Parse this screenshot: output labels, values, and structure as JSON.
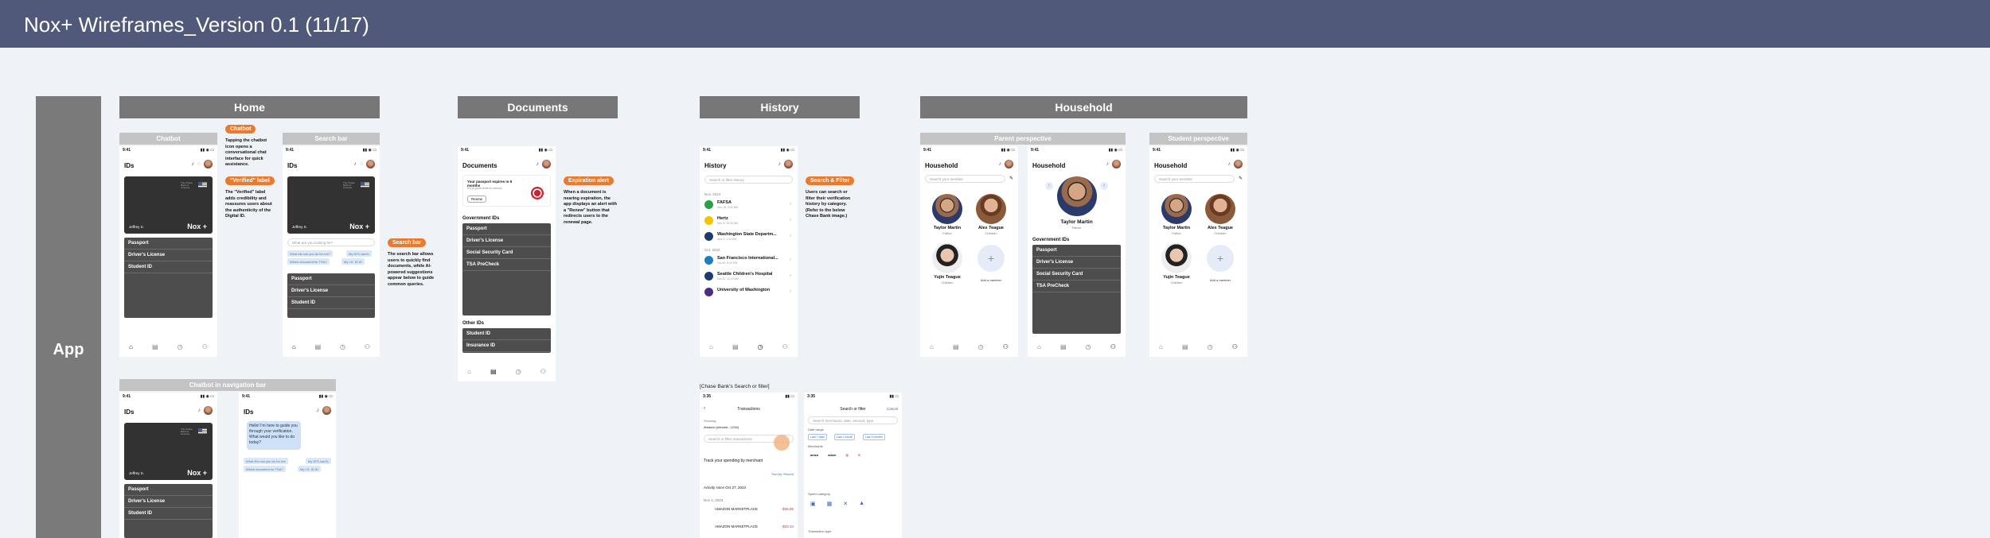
{
  "board": {
    "title": "Nox+ Wireframes_Version 0.1 (11/17)",
    "app_label": "App"
  },
  "sections": {
    "home": "Home",
    "documents": "Documents",
    "history": "History",
    "household": "Household"
  },
  "subs": {
    "chatbot": "Chatbot",
    "search_bar": "Search bar",
    "chatbot_nav": "Chatbot in navigation bar",
    "parent": "Parent perspective",
    "student": "Student perspective"
  },
  "phone": {
    "time": "9:41",
    "ids": "IDs",
    "documents": "Documents",
    "history": "History",
    "household": "Household",
    "holder": "Jeffrey S.",
    "brand": "Nox +",
    "bank": "The Chase Bank of America"
  },
  "id_list": [
    "Passport",
    "Driver's License",
    "Student ID"
  ],
  "home_search": {
    "placeholder": "What are you looking for?",
    "pills": [
      "What ids can you do for me?",
      "My ID'S card's",
      "Which document for TSA?",
      "My I.D. ID ID"
    ]
  },
  "chat": {
    "message": "Hello! I'm here to guide you through your verification. What would you like to do today?",
    "pills": [
      "What IDs can you do for me",
      "My ID'S card's",
      "Which document for TSA?",
      "My I.D. ID ID"
    ]
  },
  "badges": {
    "chatbot": "Chatbot",
    "verified": "\"Verified\" label",
    "search_bar": "Search bar",
    "expiration": "Expiration alert",
    "search_filter": "Search & Filter"
  },
  "notes": {
    "chatbot": "Tapping the chatbot icon opens a conversational chat interface for quick assistance.",
    "verified": "The \"Verified\" label adds credibility and reassures users about the authenticity of the Digital ID.",
    "search_bar": "The search bar allows users to quickly find documents, while AI-powered suggestions appear below to guide common queries.",
    "expiration": "When a document is nearing expiration, the app displays an alert with a \"Renew\" button that redirects users to the renewal page.",
    "search_filter": "Users can search or filter their verification history by category. (Refer to the below Chase Bank image.)"
  },
  "documents": {
    "alert": "Your passport expires in 6 months",
    "alert_sub": "It's a good time to renew",
    "renew": "Renew",
    "gov_ids": "Government IDs",
    "gov_list": [
      "Passport",
      "Driver's License",
      "Social Security Card",
      "TSA PreCheck"
    ],
    "other_ids": "Other IDs",
    "other_list": [
      "Student ID",
      "Insurance ID"
    ]
  },
  "history": {
    "search": "Search or filter history",
    "month1": "Nov, 2023",
    "month2": "Oct, 2023",
    "items": [
      {
        "name": "FAFSA",
        "date": "Nov 15, 9:41 AM",
        "color": "#2a9f4a"
      },
      {
        "name": "Hertz",
        "date": "Nov 9, 10:20 AM",
        "color": "#f5c400"
      },
      {
        "name": "Washington State Departm...",
        "date": "Nov 2, 1:14 PM",
        "color": "#1c3c6e"
      },
      {
        "name": "San Francisco International...",
        "date": "Oct 30, 5:22 PM",
        "color": "#1d7fbf"
      },
      {
        "name": "Seattle Children's Hospital",
        "date": "Oct 22, 11:10 AM",
        "color": "#1c3c6e"
      },
      {
        "name": "University of Washington",
        "date": "",
        "color": "#4b2e83"
      }
    ]
  },
  "household": {
    "search": "Search your member",
    "members": [
      {
        "name": "Taylor Martin",
        "role": "Father"
      },
      {
        "name": "Alex Teague",
        "role": "Children"
      },
      {
        "name": "Yujin Teague",
        "role": "Children"
      }
    ],
    "add": "Add a member",
    "gov_ids": "Government IDs",
    "gov_list": [
      "Passport",
      "Driver's License",
      "Social Security Card",
      "TSA PreCheck"
    ]
  },
  "chase": {
    "caption": "[Chase Bank's Search or filter]",
    "time": "3:35",
    "tx_title": "Transactions",
    "cancel": "Cancel",
    "filter_title": "Search or filter",
    "showing": "Showing",
    "account": "Amazon (chrome...1234)",
    "search": "Search or filter transactions",
    "filter_search": "Search merchants, date, amount, type",
    "track": "Track your spending by merchant",
    "sort": "Sort by: Recent",
    "activity": "Activity since Oct 27, 2023",
    "date_range": "Date range",
    "ranges": [
      "Last 7 days",
      "Last 1 month",
      "Last 3 months"
    ],
    "merchants": "Merchants",
    "spend": "Spend category",
    "tx_type": "Transaction type",
    "rows": [
      {
        "date": "Nov 1, 2023",
        "name": "AMAZON MARKETPLACE",
        "amt": "-$35.85"
      },
      {
        "date": "",
        "name": "AMAZON MARKETPLACE",
        "amt": "-$33.34"
      }
    ]
  }
}
